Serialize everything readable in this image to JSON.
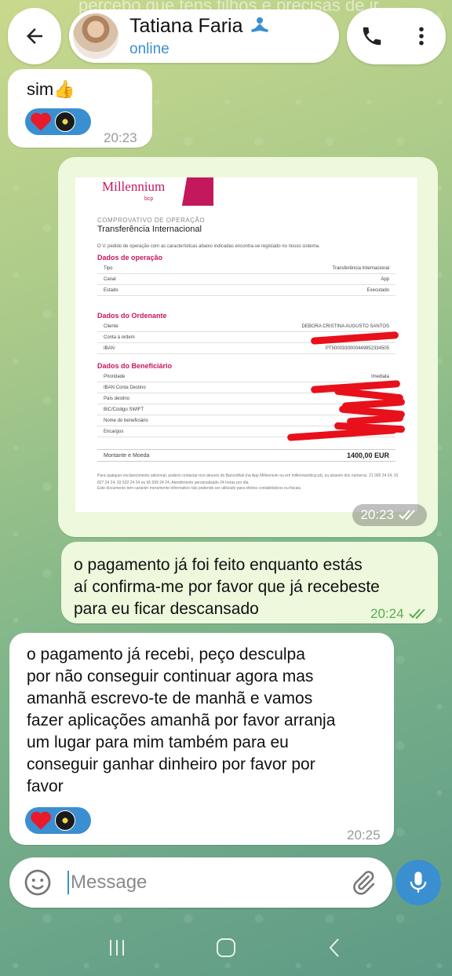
{
  "header": {
    "background_text": "percebo que tens filhos e precisas de ir",
    "contact_name": "Tatiana Faria",
    "status": "online",
    "badge_icon": "meditation-emoji-icon",
    "icons": [
      "back-arrow-icon",
      "phone-icon",
      "more-vert-icon"
    ]
  },
  "messages": [
    {
      "direction": "incoming",
      "text": "sim👍",
      "time": "20:23",
      "reactions": [
        "red-heart",
        "user-avatar"
      ]
    },
    {
      "direction": "outgoing",
      "type": "photo",
      "time": "20:23",
      "read": true,
      "receipt": {
        "brand": "Millennium",
        "brand_sub": "bcp",
        "label": "COMPROVATIVO DE OPERAÇÃO",
        "title": "Transferência Internacional",
        "note": "O V. pedido de operação com as características abaixo indicadas encontra-se registado no nosso sistema.",
        "sections": [
          {
            "heading": "Dados de operação",
            "rows": [
              {
                "label": "Tipo",
                "value": "Transferência Internacional"
              },
              {
                "label": "Canal",
                "value": "App"
              },
              {
                "label": "Estado",
                "value": "Executado"
              }
            ]
          },
          {
            "heading": "Dados do Ordenante",
            "rows": [
              {
                "label": "Cliente",
                "value": "DEBORA CRISTINA AUGUSTO SANTOS"
              },
              {
                "label": "Conta à ordem",
                "value": ""
              },
              {
                "label": "IBAN",
                "value": "PT50003300004498523345​05"
              }
            ]
          },
          {
            "heading": "Dados do Beneficiário",
            "rows": [
              {
                "label": "Prioridade",
                "value": "Imediata"
              },
              {
                "label": "IBAN Conta Destino",
                "value": ""
              },
              {
                "label": "País destino",
                "value": ""
              },
              {
                "label": "BIC/Código SWIFT",
                "value": ""
              },
              {
                "label": "Nome do beneficiário",
                "value": ""
              },
              {
                "label": "Encargos",
                "value": ""
              }
            ]
          }
        ],
        "amount_label": "Montante e Moeda",
        "amount_value": "1400,00 EUR",
        "footer_1": "Para qualquer esclarecimento adicional, poderá contactar-nos através do BancoMail (na App Millennium ou em millenniumbcp.pt), ou através dos números: 21 005 24 24, 91 827 24 24, 93 522 24 24 ou 96 599 24 24. Atendimento personalizado 24 horas por dia.",
        "footer_2": "Este documento tem carácter meramente informativo não podendo ser utilizado para efeitos contabilísticos ou fiscais."
      }
    },
    {
      "direction": "outgoing",
      "lines": [
        "o pagamento já foi feito enquanto estás",
        "aí confirma-me por favor que já recebeste",
        "para eu ficar descansado"
      ],
      "time": "20:24",
      "read": true
    },
    {
      "direction": "incoming",
      "lines": [
        "o pagamento já recebi, peço desculpa",
        "por não conseguir continuar agora mas",
        "amanhã escrevo-te de manhã e vamos",
        "fazer aplicações amanhã por favor arranja",
        "um lugar para mim também para eu",
        "conseguir ganhar dinheiro por favor por",
        "favor"
      ],
      "time": "20:25",
      "reactions": [
        "red-heart",
        "user-avatar"
      ]
    }
  ],
  "composer": {
    "placeholder": "Message",
    "icons": [
      "emoji-icon",
      "attach-icon",
      "mic-icon"
    ]
  },
  "colors": {
    "accent": "#3a8fd0",
    "outgoing_bubble": "#edf8dc",
    "read_check": "#5aab52",
    "brand": "#c4185c"
  }
}
